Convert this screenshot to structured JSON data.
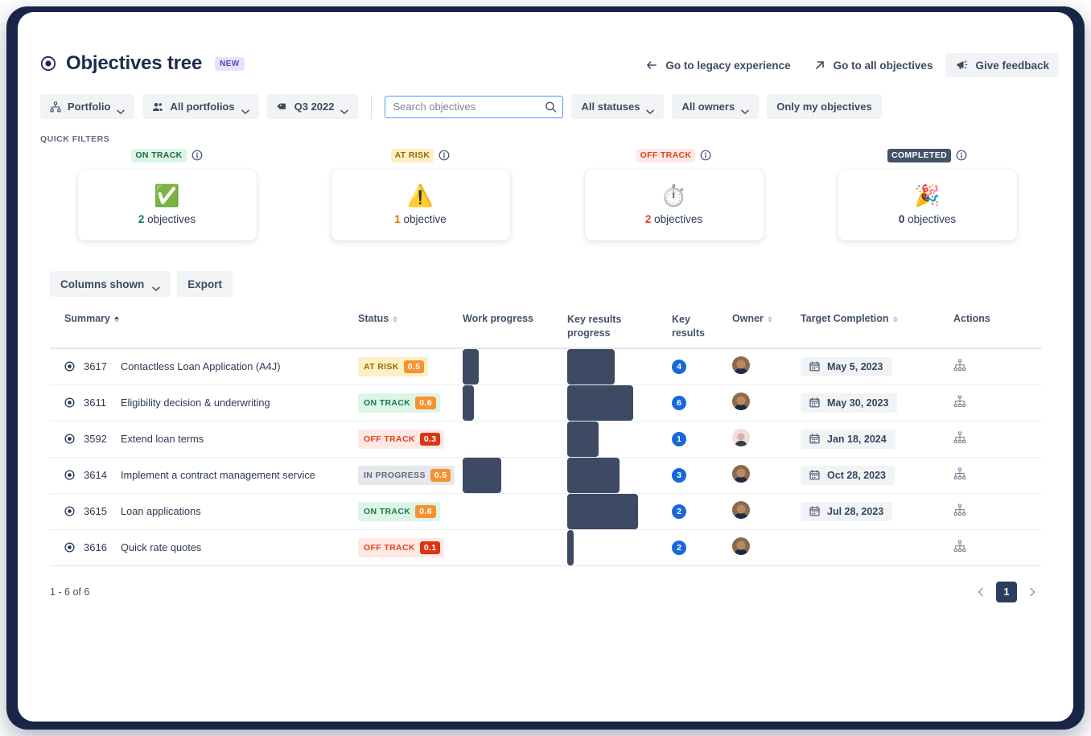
{
  "header": {
    "title": "Objectives tree",
    "new_badge": "NEW",
    "title_icon": "target-icon",
    "actions": [
      {
        "label": "Go to legacy experience",
        "icon": "arrow-left-icon",
        "filled": false
      },
      {
        "label": "Go to all objectives",
        "icon": "arrow-up-right-icon",
        "filled": false
      },
      {
        "label": "Give feedback",
        "icon": "megaphone-icon",
        "filled": true
      }
    ]
  },
  "filters": {
    "portfolio": {
      "label": "Portfolio",
      "icon": "hierarchy-icon"
    },
    "all_portfolios": {
      "label": "All portfolios",
      "icon": "people-icon"
    },
    "quarter": {
      "label": "Q3 2022",
      "icon": "tag-icon"
    },
    "search": {
      "value": "",
      "placeholder": "Search objectives",
      "icon": "search-icon"
    },
    "all_statuses": {
      "label": "All statuses"
    },
    "all_owners": {
      "label": "All owners"
    },
    "only_mine": {
      "label": "Only my objectives"
    }
  },
  "quick_filters": {
    "section_label": "QUICK FILTERS",
    "cards": [
      {
        "status": "ON TRACK",
        "emoji": "✅",
        "count": "2",
        "unit": "objectives",
        "pill_class": "pill-ontrack",
        "count_class": "c-green"
      },
      {
        "status": "AT RISK",
        "emoji": "⚠️",
        "count": "1",
        "unit": "objective",
        "pill_class": "pill-atrisk",
        "count_class": "c-orange"
      },
      {
        "status": "OFF TRACK",
        "emoji": "⏱️",
        "count": "2",
        "unit": "objectives",
        "pill_class": "pill-offtrack",
        "count_class": "c-red"
      },
      {
        "status": "COMPLETED",
        "emoji": "🎉",
        "count": "0",
        "unit": "objectives",
        "pill_class": "pill-completed",
        "count_class": "c-dark"
      }
    ]
  },
  "table_toolbar": {
    "columns_shown": "Columns shown",
    "export": "Export"
  },
  "table": {
    "columns": [
      {
        "label": "Summary",
        "sortable": true,
        "sorted": "asc"
      },
      {
        "label": "Status",
        "sortable": true
      },
      {
        "label": "Work progress",
        "sortable": false
      },
      {
        "label": "Key results progress",
        "sortable": false
      },
      {
        "label": "Key results",
        "sortable": false
      },
      {
        "label": "Owner",
        "sortable": true
      },
      {
        "label": "Target Completion",
        "sortable": true
      },
      {
        "label": "Actions",
        "sortable": false
      }
    ],
    "rows": [
      {
        "id": "3617",
        "summary": "Contactless Loan Application (A4J)",
        "status_label": "AT RISK",
        "status_score": "0.5",
        "status_class": "bs-atrisk",
        "work_progress": 15,
        "key_results_progress": 45,
        "key_results": "4",
        "owner_variant": "brown",
        "target_completion": "May 5, 2023"
      },
      {
        "id": "3611",
        "summary": "Eligibility decision & underwriting",
        "status_label": "ON TRACK",
        "status_score": "0.6",
        "status_class": "bs-ontrack",
        "work_progress": 11,
        "key_results_progress": 63,
        "key_results": "6",
        "owner_variant": "brown",
        "target_completion": "May 30, 2023"
      },
      {
        "id": "3592",
        "summary": "Extend loan terms",
        "status_label": "OFF TRACK",
        "status_score": "0.3",
        "status_class": "bs-offtrack",
        "work_progress": 0,
        "key_results_progress": 30,
        "key_results": "1",
        "owner_variant": "alt",
        "target_completion": "Jan 18, 2024"
      },
      {
        "id": "3614",
        "summary": "Implement a contract management service",
        "status_label": "IN PROGRESS",
        "status_score": "0.5",
        "status_class": "bs-inprogress",
        "work_progress": 37,
        "key_results_progress": 50,
        "key_results": "3",
        "owner_variant": "brown",
        "target_completion": "Oct 28, 2023"
      },
      {
        "id": "3615",
        "summary": "Loan applications",
        "status_label": "ON TRACK",
        "status_score": "0.6",
        "status_class": "bs-ontrack",
        "work_progress": 0,
        "key_results_progress": 68,
        "key_results": "2",
        "owner_variant": "brown",
        "target_completion": "Jul 28, 2023"
      },
      {
        "id": "3616",
        "summary": "Quick rate quotes",
        "status_label": "OFF TRACK",
        "status_score": "0.1",
        "status_class": "bs-offtrack",
        "work_progress": 0,
        "key_results_progress": 6,
        "key_results": "2",
        "owner_variant": "brown",
        "target_completion": ""
      }
    ]
  },
  "footer": {
    "result_count": "1 - 6 of 6",
    "current_page": "1",
    "prev_label": "‹",
    "next_label": "›"
  },
  "colors": {
    "frame": "#172546",
    "accent_blue": "#1868db",
    "on_track": "#18794e",
    "at_risk": "#e07000",
    "off_track": "#e3401c",
    "progress_fill": "#3c4a63"
  }
}
